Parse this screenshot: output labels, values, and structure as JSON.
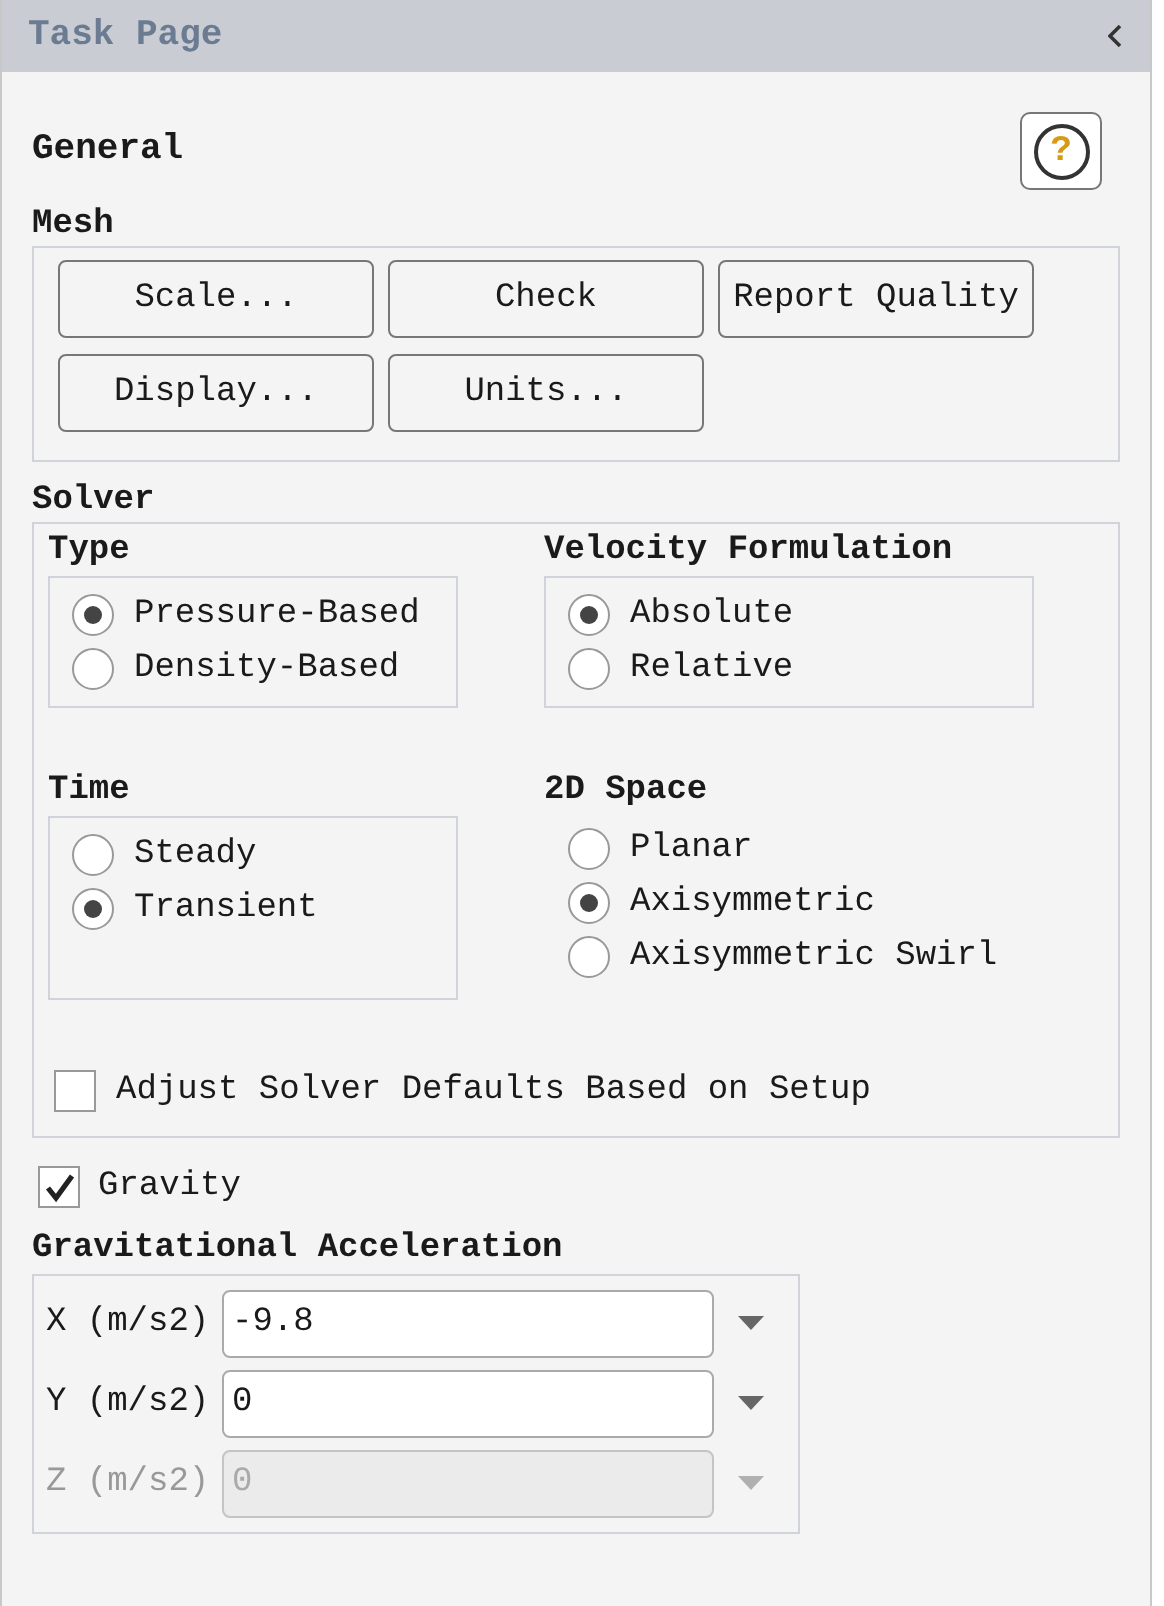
{
  "panel": {
    "title": "Task Page"
  },
  "page": {
    "heading": "General",
    "help_glyph": "?"
  },
  "mesh": {
    "label": "Mesh",
    "buttons": [
      "Scale...",
      "Check",
      "Report Quality",
      "Display...",
      "Units..."
    ]
  },
  "solver": {
    "label": "Solver",
    "groups": [
      {
        "label": "Type",
        "framed": true,
        "options": [
          {
            "label": "Pressure-Based",
            "selected": true
          },
          {
            "label": "Density-Based",
            "selected": false
          }
        ]
      },
      {
        "label": "Velocity Formulation",
        "framed": true,
        "options": [
          {
            "label": "Absolute",
            "selected": true
          },
          {
            "label": "Relative",
            "selected": false
          }
        ]
      },
      {
        "label": "Time",
        "framed": true,
        "options": [
          {
            "label": "Steady",
            "selected": false
          },
          {
            "label": "Transient",
            "selected": true
          }
        ]
      },
      {
        "label": "2D Space",
        "framed": false,
        "options": [
          {
            "label": "Planar",
            "selected": false
          },
          {
            "label": "Axisymmetric",
            "selected": true
          },
          {
            "label": "Axisymmetric Swirl",
            "selected": false
          }
        ]
      }
    ],
    "adjust_defaults": {
      "label": "Adjust Solver Defaults Based on Setup",
      "checked": false
    }
  },
  "gravity": {
    "label": "Gravity",
    "checked": true
  },
  "gravitational_acceleration": {
    "label": "Gravitational Acceleration",
    "rows": [
      {
        "label": "X (m/s2)",
        "value": "-9.8",
        "disabled": false
      },
      {
        "label": "Y (m/s2)",
        "value": "0",
        "disabled": false
      },
      {
        "label": "Z (m/s2)",
        "value": "0",
        "disabled": true
      }
    ]
  }
}
